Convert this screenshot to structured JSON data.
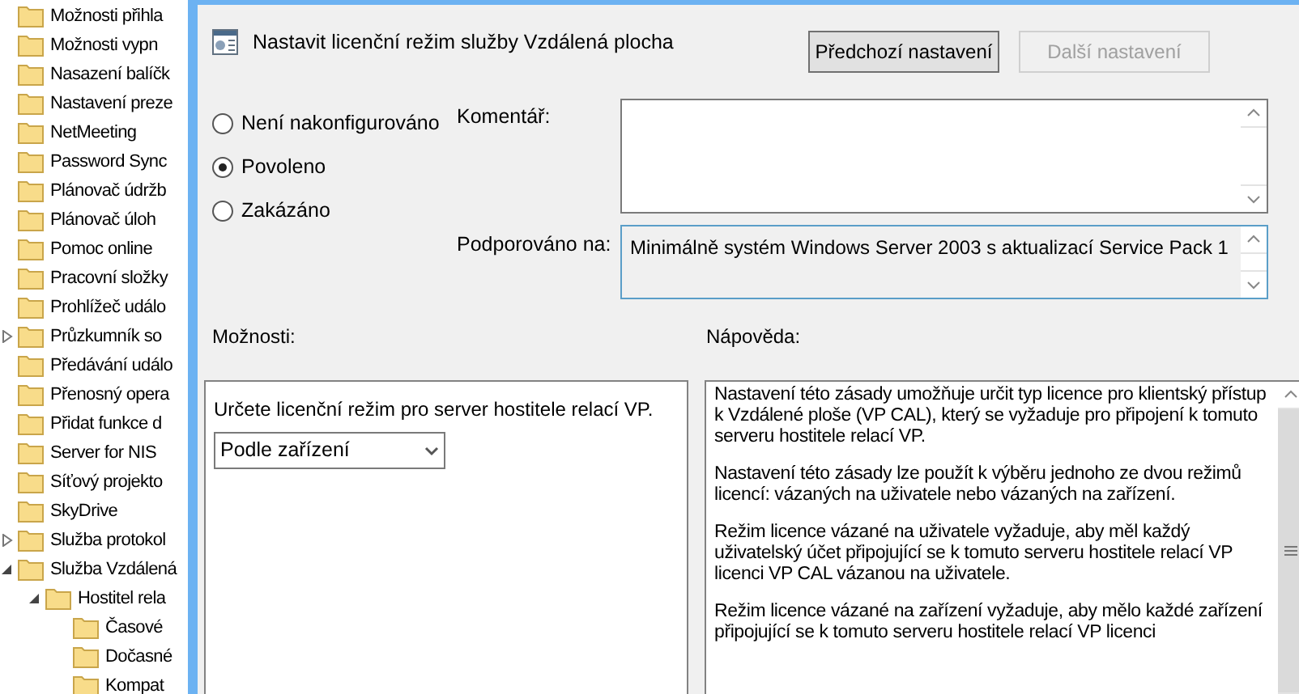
{
  "tree": {
    "items": [
      {
        "label": "Možnosti přihla",
        "kind": "folder"
      },
      {
        "label": "Možnosti vypn",
        "kind": "folder"
      },
      {
        "label": "Nasazení balíčk",
        "kind": "folder"
      },
      {
        "label": "Nastavení preze",
        "kind": "folder"
      },
      {
        "label": "NetMeeting",
        "kind": "folder"
      },
      {
        "label": "Password Sync",
        "kind": "folder"
      },
      {
        "label": "Plánovač údržb",
        "kind": "folder"
      },
      {
        "label": "Plánovač úloh",
        "kind": "folder"
      },
      {
        "label": "Pomoc online",
        "kind": "folder"
      },
      {
        "label": "Pracovní složky",
        "kind": "folder"
      },
      {
        "label": "Prohlížeč událo",
        "kind": "folder"
      },
      {
        "label": "Průzkumník so",
        "kind": "branch",
        "expanded": false
      },
      {
        "label": "Předávání událo",
        "kind": "folder"
      },
      {
        "label": "Přenosný opera",
        "kind": "folder"
      },
      {
        "label": "Přidat funkce d",
        "kind": "folder"
      },
      {
        "label": "Server for NIS",
        "kind": "folder"
      },
      {
        "label": "Síťový projekto",
        "kind": "folder"
      },
      {
        "label": "SkyDrive",
        "kind": "folder"
      },
      {
        "label": "Služba protokol",
        "kind": "branch",
        "expanded": false
      },
      {
        "label": "Služba Vzdálená",
        "kind": "branch",
        "expanded": true,
        "children": [
          {
            "label": "Hostitel rela",
            "kind": "branch",
            "expanded": true,
            "children": [
              {
                "label": "Časové",
                "kind": "folder"
              },
              {
                "label": "Dočasné",
                "kind": "folder"
              },
              {
                "label": "Kompat",
                "kind": "folder"
              }
            ]
          }
        ]
      }
    ]
  },
  "dialog": {
    "title": "Nastavit licenční režim služby Vzdálená plocha",
    "buttons": [
      {
        "label": "Předchozí nastavení",
        "disabled": false
      },
      {
        "label": "Další nastavení",
        "disabled": true
      }
    ],
    "radios": [
      {
        "label": "Není nakonfigurováno",
        "selected": false
      },
      {
        "label": "Povoleno",
        "selected": true
      },
      {
        "label": "Zakázáno",
        "selected": false
      }
    ],
    "comment_label": "Komentář:",
    "supported_label": "Podporováno na:",
    "supported_value": "Minimálně systém Windows Server 2003 s aktualizací Service Pack 1",
    "options_label": "Možnosti:",
    "help_label": "Nápověda:",
    "options": {
      "prompt": "Určete licenční režim pro server hostitele relací VP.",
      "dropdown_value": "Podle zařízení"
    },
    "help": [
      "Nastavení této zásady umožňuje určit typ licence pro klientský přístup k Vzdálené ploše (VP CAL), který se vyžaduje pro připojení k tomuto serveru hostitele relací VP.",
      "Nastavení této zásady lze použít k výběru jednoho ze dvou režimů licencí: vázaných na uživatele nebo vázaných na zařízení.",
      "Režim licence vázané na uživatele vyžaduje, aby měl každý uživatelský účet připojující se k tomuto serveru hostitele relací VP licenci VP CAL vázanou na uživatele.",
      "Režim licence vázané na zařízení vyžaduje, aby mělo každé zařízení připojující se k tomuto serveru hostitele relací VP licenci"
    ]
  }
}
